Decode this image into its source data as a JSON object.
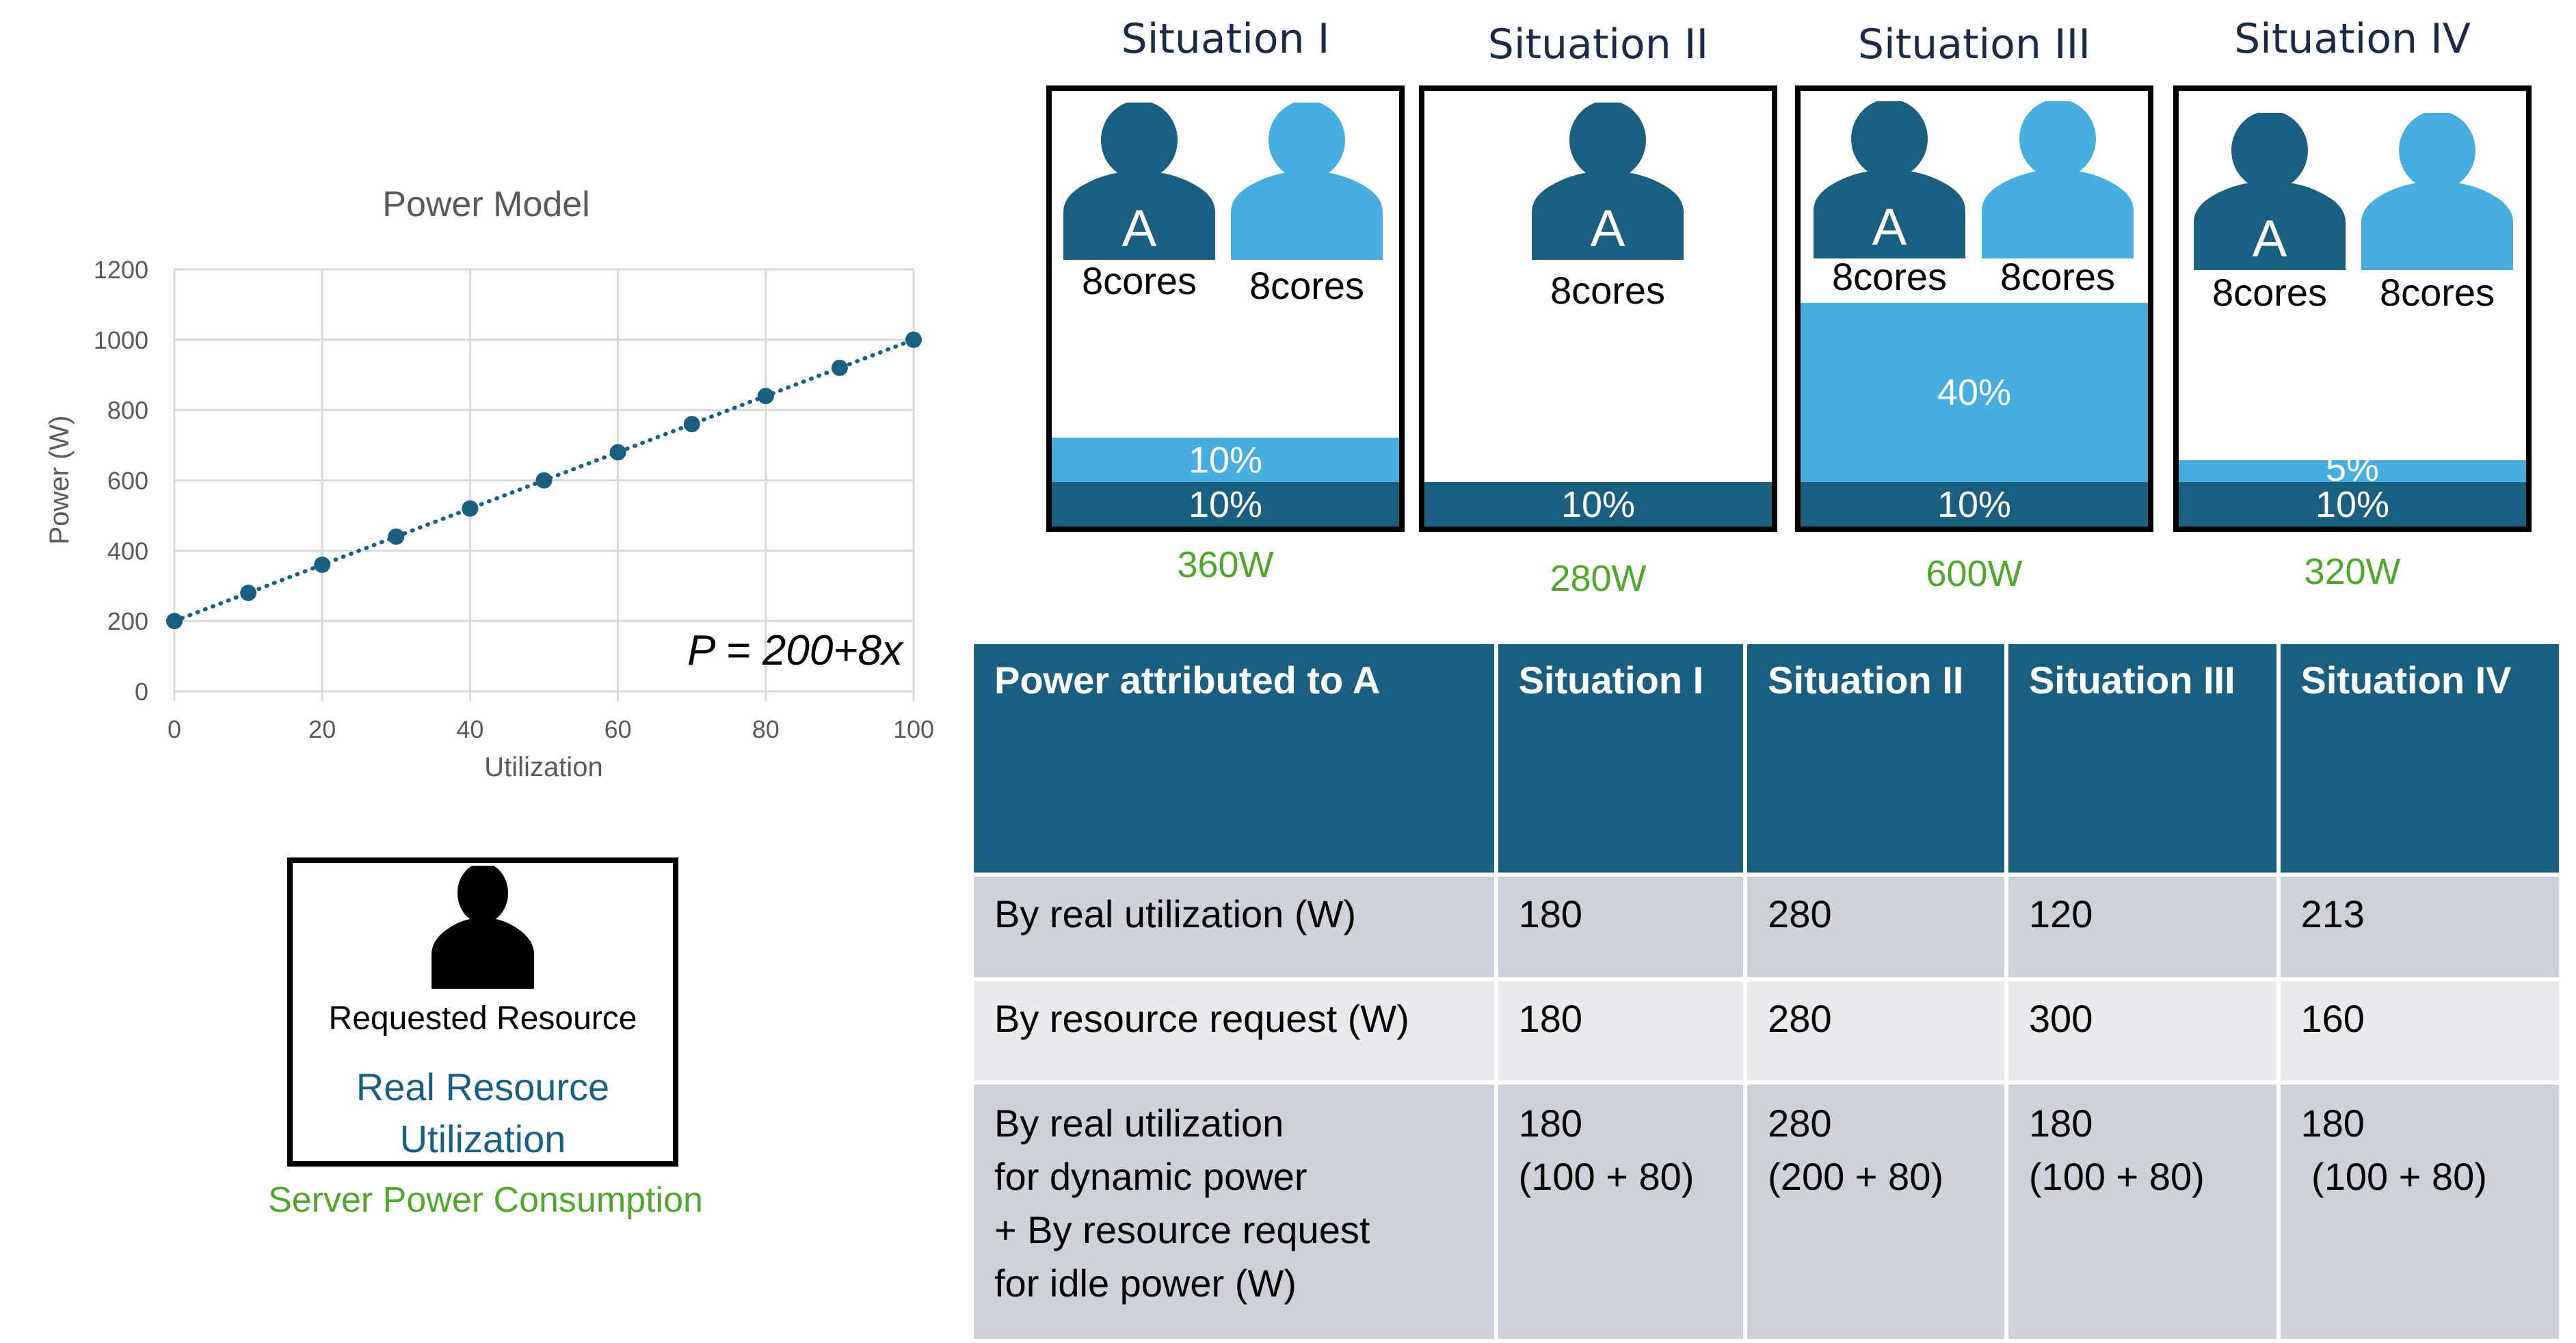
{
  "chart_data": {
    "type": "scatter",
    "title": "Power Model",
    "xlabel": "Utilization",
    "ylabel": "Power (W)",
    "xlim": [
      0,
      100
    ],
    "ylim": [
      0,
      1200
    ],
    "xticks": [
      0,
      20,
      40,
      60,
      80,
      100
    ],
    "yticks": [
      0,
      200,
      400,
      600,
      800,
      1000,
      1200
    ],
    "grid": true,
    "trendline": "dotted linear",
    "annotation": "P = 200+8x",
    "series": [
      {
        "name": "Power",
        "color": "#1a5f80",
        "x": [
          0,
          10,
          20,
          30,
          40,
          50,
          60,
          70,
          80,
          90,
          100
        ],
        "y": [
          200,
          280,
          360,
          440,
          520,
          600,
          680,
          760,
          840,
          920,
          1000
        ]
      }
    ]
  },
  "legend": {
    "requested": "Requested Resource",
    "real_line1": "Real Resource",
    "real_line2": "Utilization",
    "power": "Server Power Consumption"
  },
  "colors": {
    "user_a": "#1a5f80",
    "other_user": "#48aedf",
    "power_text": "#52a52e",
    "table_header": "#1a5f80"
  },
  "situations": [
    {
      "title": "Situation I",
      "users": [
        {
          "label": "A",
          "cores": "8cores",
          "type": "a"
        },
        {
          "label": "",
          "cores": "8cores",
          "type": "other"
        }
      ],
      "bars": [
        {
          "label": "10%",
          "type": "light",
          "pct": 10
        },
        {
          "label": "10%",
          "type": "dark",
          "pct": 10
        }
      ],
      "power": "360W"
    },
    {
      "title": "Situation II",
      "users": [
        {
          "label": "A",
          "cores": "8cores",
          "type": "a"
        }
      ],
      "bars": [
        {
          "label": "10%",
          "type": "dark",
          "pct": 10
        }
      ],
      "power": "280W"
    },
    {
      "title": "Situation III",
      "users": [
        {
          "label": "A",
          "cores": "8cores",
          "type": "a"
        },
        {
          "label": "",
          "cores": "8cores",
          "type": "other"
        }
      ],
      "bars": [
        {
          "label": "40%",
          "type": "light",
          "pct": 40
        },
        {
          "label": "10%",
          "type": "dark",
          "pct": 10
        }
      ],
      "power": "600W"
    },
    {
      "title": "Situation IV",
      "users": [
        {
          "label": "A",
          "cores": "8cores",
          "type": "a"
        },
        {
          "label": "",
          "cores": "8cores",
          "type": "other"
        }
      ],
      "bars": [
        {
          "label": "5%",
          "type": "light",
          "pct": 5
        },
        {
          "label": "10%",
          "type": "dark",
          "pct": 10
        }
      ],
      "power": "320W"
    }
  ],
  "table": {
    "headers": [
      "Power attributed to A",
      "Situation I",
      "Situation II",
      "Situation III",
      "Situation IV"
    ],
    "rows": [
      {
        "label": [
          "By real utilization (W)"
        ],
        "cells": [
          [
            "180"
          ],
          [
            "280"
          ],
          [
            "120"
          ],
          [
            "213"
          ]
        ]
      },
      {
        "label": [
          "By resource request (W)"
        ],
        "cells": [
          [
            "180"
          ],
          [
            "280"
          ],
          [
            "300"
          ],
          [
            "160"
          ]
        ]
      },
      {
        "label": [
          "By real utilization",
          "for dynamic power",
          "+ By resource request",
          "for idle power (W)"
        ],
        "cells": [
          [
            "180",
            "(100 + 80)"
          ],
          [
            "280",
            "(200 + 80)"
          ],
          [
            "180",
            "(100 + 80)"
          ],
          [
            "180",
            " (100 + 80)"
          ]
        ]
      }
    ]
  }
}
